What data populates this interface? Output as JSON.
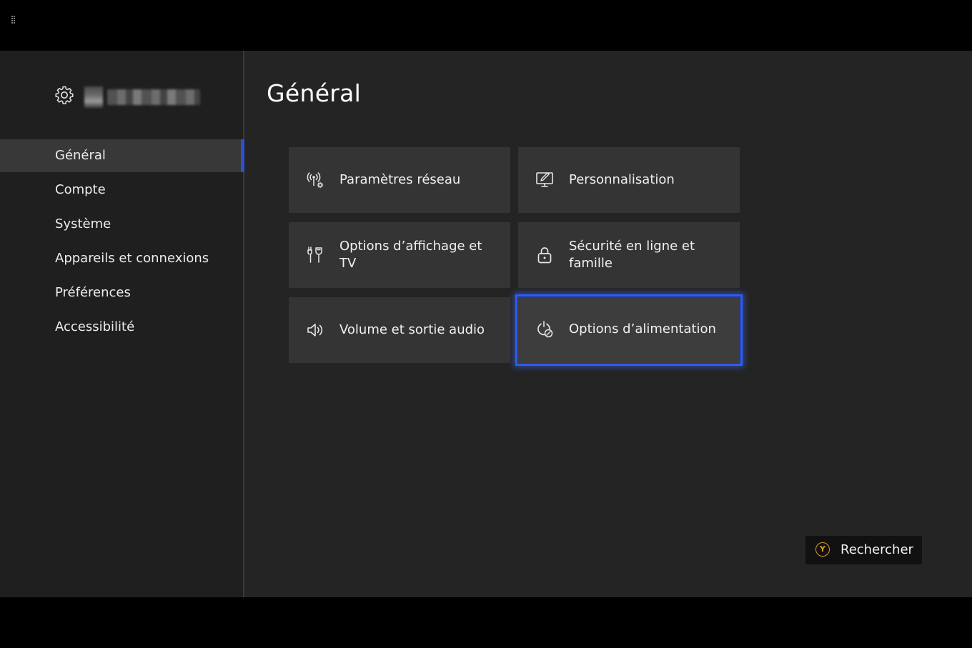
{
  "page": {
    "title": "Général"
  },
  "profile": {
    "icon": "gear-icon"
  },
  "sidebar": {
    "items": [
      {
        "label": "Général",
        "active": true
      },
      {
        "label": "Compte",
        "active": false
      },
      {
        "label": "Système",
        "active": false
      },
      {
        "label": "Appareils et connexions",
        "active": false
      },
      {
        "label": "Préférences",
        "active": false
      },
      {
        "label": "Accessibilité",
        "active": false
      }
    ]
  },
  "tiles": [
    {
      "label": "Paramètres réseau",
      "icon": "network-settings-icon",
      "focused": false
    },
    {
      "label": "Personnalisation",
      "icon": "personalization-icon",
      "focused": false
    },
    {
      "label": "Options d’affichage et TV",
      "icon": "display-tv-icon",
      "focused": false
    },
    {
      "label": "Sécurité en ligne et famille",
      "icon": "lock-icon",
      "focused": false
    },
    {
      "label": "Volume et sortie audio",
      "icon": "speaker-icon",
      "focused": false
    },
    {
      "label": "Options d’alimentation",
      "icon": "power-leaf-icon",
      "focused": true
    }
  ],
  "search_button": {
    "key": "Y",
    "label": "Rechercher"
  },
  "colors": {
    "accent": "#2f5cf2",
    "y_button": "#d99a2b",
    "background": "#242424",
    "tile": "#343434"
  }
}
